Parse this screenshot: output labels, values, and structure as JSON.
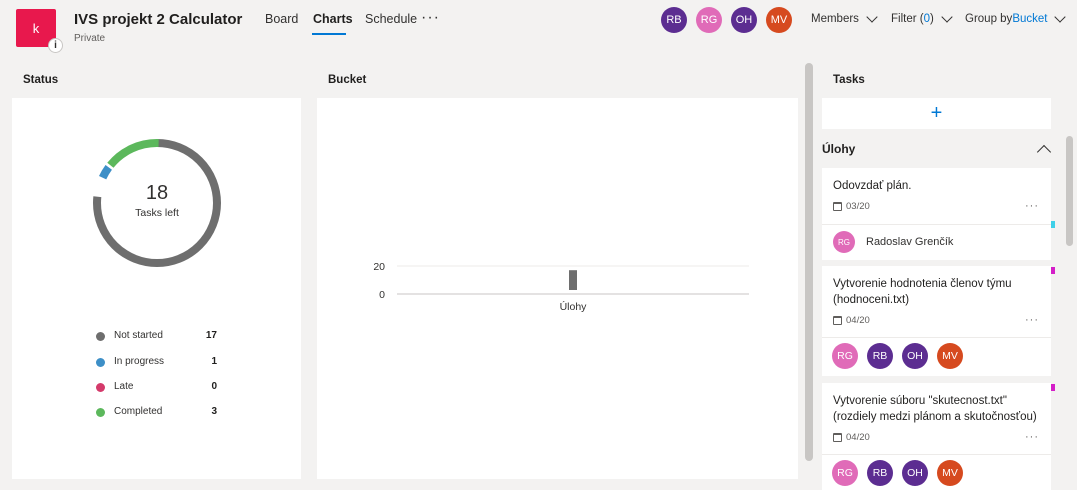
{
  "header": {
    "logo_letter": "k",
    "logo_info": "i",
    "title": "IVS projekt 2 Calculator",
    "privacy": "Private",
    "tabs": [
      {
        "label": "Board"
      },
      {
        "label": "Charts",
        "active": true
      },
      {
        "label": "Schedule"
      }
    ],
    "more": "···",
    "members": [
      {
        "initials": "RB",
        "color": "#5c2d91"
      },
      {
        "initials": "RG",
        "color": "#e06bb8"
      },
      {
        "initials": "OH",
        "color": "#5c2d91"
      },
      {
        "initials": "MV",
        "color": "#d64a1f"
      }
    ],
    "members_label": "Members",
    "filter_label": "Filter (",
    "filter_count": "0",
    "filter_close": ")",
    "groupby_label": "Group by ",
    "groupby_value": "Bucket"
  },
  "status_panel": {
    "title": "Status",
    "tasks_left_number": "18",
    "tasks_left_label": "Tasks left",
    "legend": [
      {
        "label": "Not started",
        "count": "17",
        "color": "#6e6e6e"
      },
      {
        "label": "In progress",
        "count": "1",
        "color": "#3d8fc7"
      },
      {
        "label": "Late",
        "count": "0",
        "color": "#d43a6b"
      },
      {
        "label": "Completed",
        "count": "3",
        "color": "#5cb85c"
      }
    ]
  },
  "bucket_panel": {
    "title": "Bucket"
  },
  "chart_data": {
    "type": "bar",
    "categories": [
      "Úlohy"
    ],
    "values": [
      17
    ],
    "yticks": [
      "20",
      "0"
    ],
    "ylim": [
      0,
      20
    ],
    "title": "",
    "xlabel": "",
    "ylabel": ""
  },
  "tasks_panel": {
    "title": "Tasks",
    "add_symbol": "+",
    "bucket_name": "Úlohy",
    "cards": [
      {
        "title": "Odovzdať plán.",
        "date": "03/20",
        "more": "···",
        "assignee_initials": "RG",
        "assignee_name": "Radoslav Grenčík",
        "assignee_color": "#e06bb8",
        "label_color": "#3fd0e8"
      },
      {
        "title": "Vytvorenie hodnotenia členov týmu (hodnoceni.txt)",
        "date": "04/20",
        "more": "···",
        "assignees": [
          {
            "initials": "RG",
            "color": "#e06bb8"
          },
          {
            "initials": "RB",
            "color": "#5c2d91"
          },
          {
            "initials": "OH",
            "color": "#5c2d91"
          },
          {
            "initials": "MV",
            "color": "#d64a1f"
          }
        ],
        "label_color": "#d41ec8"
      },
      {
        "title": "Vytvorenie súboru \"skutecnost.txt\" (rozdiely medzi plánom a skutočnosťou)",
        "date": "04/20",
        "more": "···",
        "assignees": [
          {
            "initials": "RG",
            "color": "#e06bb8"
          },
          {
            "initials": "RB",
            "color": "#5c2d91"
          },
          {
            "initials": "OH",
            "color": "#5c2d91"
          },
          {
            "initials": "MV",
            "color": "#d64a1f"
          }
        ],
        "label_color": "#d41ec8"
      }
    ]
  }
}
